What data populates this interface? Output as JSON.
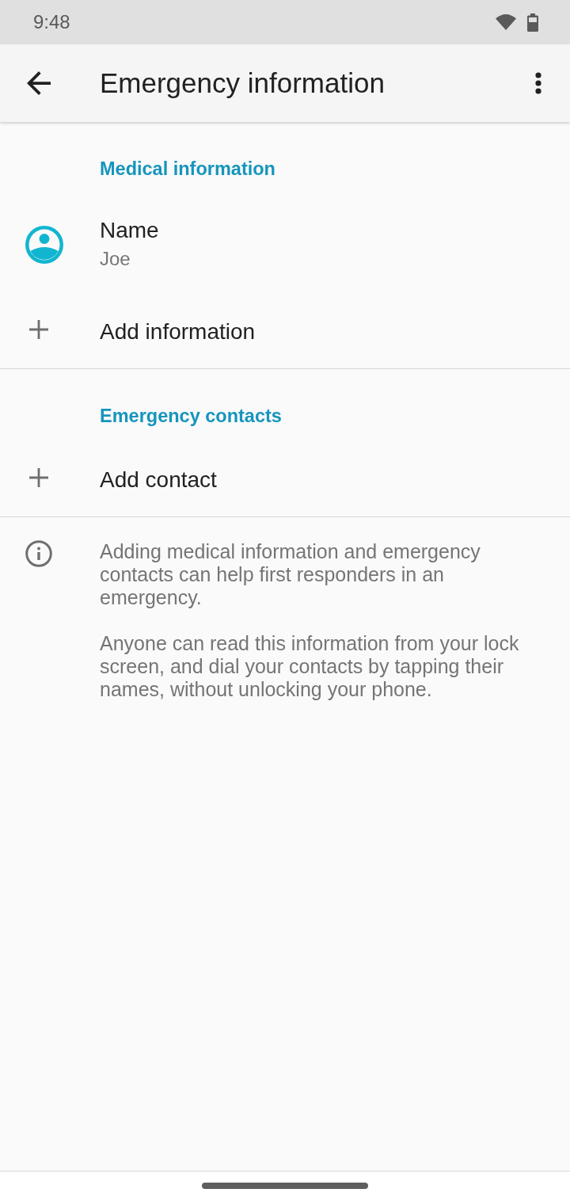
{
  "status_bar": {
    "time": "9:48"
  },
  "app_bar": {
    "title": "Emergency information"
  },
  "sections": [
    {
      "header": "Medical information",
      "items": [
        {
          "kind": "profile",
          "title": "Name",
          "subtitle": "Joe"
        },
        {
          "kind": "add",
          "title": "Add information"
        }
      ]
    },
    {
      "header": "Emergency contacts",
      "items": [
        {
          "kind": "add",
          "title": "Add contact"
        }
      ]
    }
  ],
  "info": {
    "paragraphs": [
      "Adding medical information and emergency contacts can help first responders in an emergency.",
      "Anyone can read this information from your lock screen, and dial your contacts by tapping their names, without unlocking your phone."
    ]
  }
}
